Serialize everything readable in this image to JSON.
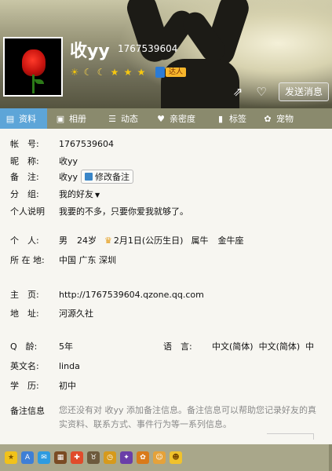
{
  "header": {
    "nickname": "收yy",
    "qq_number": "1767539604",
    "send_message": "发送消息",
    "badge_text": "达人",
    "levels": [
      "sun",
      "moon",
      "moon",
      "star",
      "star",
      "star"
    ]
  },
  "tabs": [
    {
      "label": "资料",
      "icon": "profile-card-icon"
    },
    {
      "label": "相册",
      "icon": "photo-icon"
    },
    {
      "label": "动态",
      "icon": "feed-icon"
    },
    {
      "label": "亲密度",
      "icon": "heart-icon"
    },
    {
      "label": "标签",
      "icon": "bookmark-icon"
    },
    {
      "label": "宠物",
      "icon": "pet-icon"
    }
  ],
  "profile": {
    "account_label": "帐　号:",
    "account_value": "1767539604",
    "nickname_label": "昵　称:",
    "nickname_value": "收yy",
    "remark_label": "备　注:",
    "remark_value": "收yy",
    "remark_button": "修改备注",
    "group_label": "分　组:",
    "group_value": "我的好友",
    "signature_label": "个人说明",
    "signature_value": "我要的不多，只要你爱我就够了。",
    "personal_label": "个　人:",
    "gender": "男",
    "age": "24岁",
    "birthday": "2月1日(公历生日)",
    "zodiac": "属牛",
    "constellation": "金牛座",
    "location_label": "所 在 地:",
    "location_value": "中国 广东 深圳",
    "homepage_label": "主　页:",
    "homepage_value": "http://1767539604.qzone.qq.com",
    "address_label": "地　址:",
    "address_value": "河源久社",
    "qage_label": "Q　龄:",
    "qage_value": "5年",
    "language_label": "语　言:",
    "language_value": "中文(简体)  中文(简体)  中",
    "english_label": "英文名:",
    "english_value": "linda",
    "education_label": "学　历:",
    "education_value": "初中",
    "note_label": "备注信息",
    "note_value": "您还没有对 收yy 添加备注信息。备注信息可以帮助您记录好友的真实资料、联系方式、事件行为等一系列信息。"
  },
  "apps": [
    "star-icon",
    "app-icon",
    "mail-icon",
    "game-icon",
    "gift-icon",
    "cow-icon",
    "clock-icon",
    "magic-icon",
    "pet-icon",
    "face-icon",
    "face2-icon"
  ],
  "colors": {
    "tab_bar": "#8a8a6d",
    "active_tab": "#5da5d8",
    "app_bar": "#a9a78a"
  }
}
